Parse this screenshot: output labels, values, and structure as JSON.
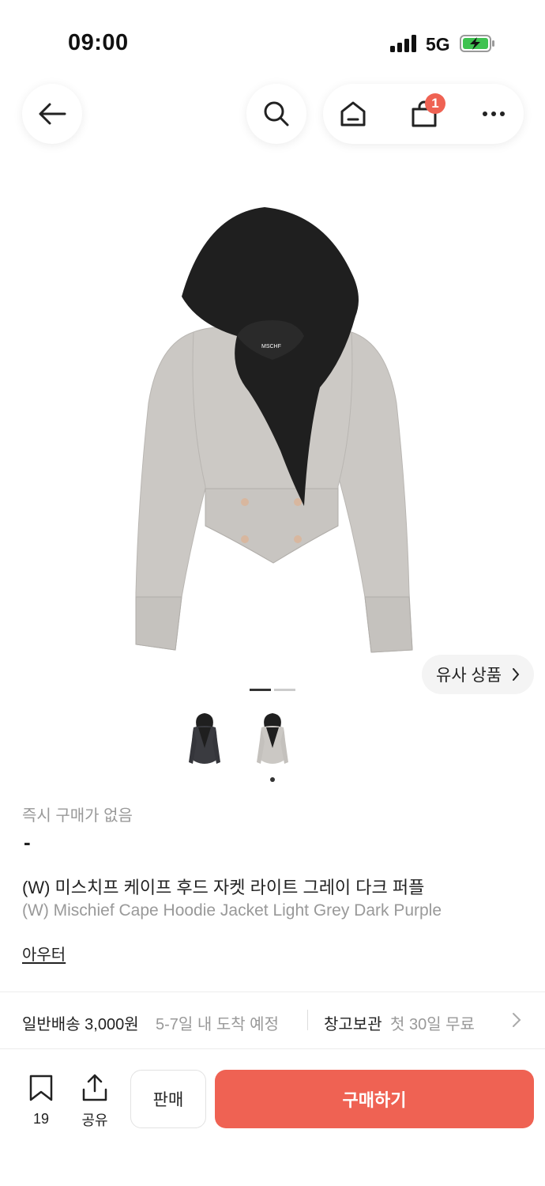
{
  "status_bar": {
    "time": "09:00",
    "network": "5G"
  },
  "nav": {
    "cart_count": "1"
  },
  "product": {
    "similar_label": "유사 상품",
    "instant_label": "즉시 구매가 없음",
    "price": "-",
    "title_ko": "(W) 미스치프 케이프 후드 자켓 라이트 그레이 다크 퍼플",
    "title_en": "(W) Mischief Cape Hoodie Jacket Light Grey Dark Purple",
    "category": "아우터",
    "brand_tag": "MSCHF",
    "image_index": 2,
    "image_count": 2
  },
  "shipping": {
    "label": "일반배송 3,000원",
    "sub": "5-7일 내 도착 예정",
    "storage_label": "창고보관",
    "storage_sub": "첫 30일 무료"
  },
  "bottom_bar": {
    "bookmark_count": "19",
    "share_label": "공유",
    "sell_label": "판매",
    "buy_label": "구매하기"
  },
  "colors": {
    "accent": "#ef6253",
    "jacket_body": "#c9c6c2",
    "hood": "#1f1f1f"
  }
}
